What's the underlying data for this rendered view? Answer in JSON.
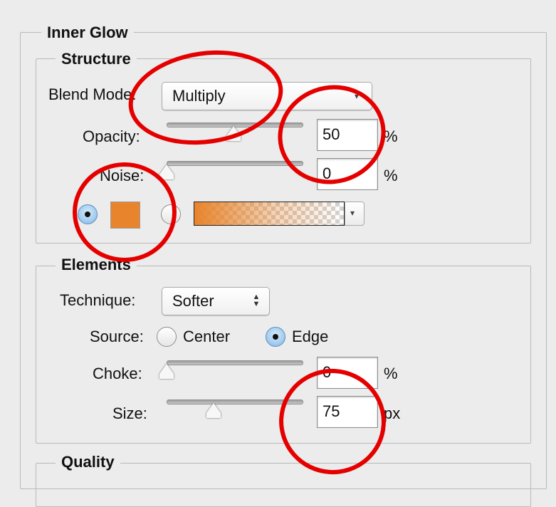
{
  "inner_glow": {
    "title": "Inner Glow",
    "structure": {
      "title": "Structure",
      "blend_mode_label": "Blend Mode:",
      "blend_mode_value": "Multiply",
      "opacity_label": "Opacity:",
      "opacity_value": "50",
      "opacity_unit": "%",
      "noise_label": "Noise:",
      "noise_value": "0",
      "noise_unit": "%",
      "glow_color": "#e8842c"
    },
    "elements": {
      "title": "Elements",
      "technique_label": "Technique:",
      "technique_value": "Softer",
      "source_label": "Source:",
      "source_center": "Center",
      "source_edge": "Edge",
      "source_selected": "Edge",
      "choke_label": "Choke:",
      "choke_value": "0",
      "choke_unit": "%",
      "size_label": "Size:",
      "size_value": "75",
      "size_unit": "px"
    },
    "quality": {
      "title": "Quality"
    }
  },
  "icons": {
    "popup_caret": "▾",
    "stepper_up": "▲",
    "stepper_down": "▼"
  },
  "annotation_color": "#e50000"
}
